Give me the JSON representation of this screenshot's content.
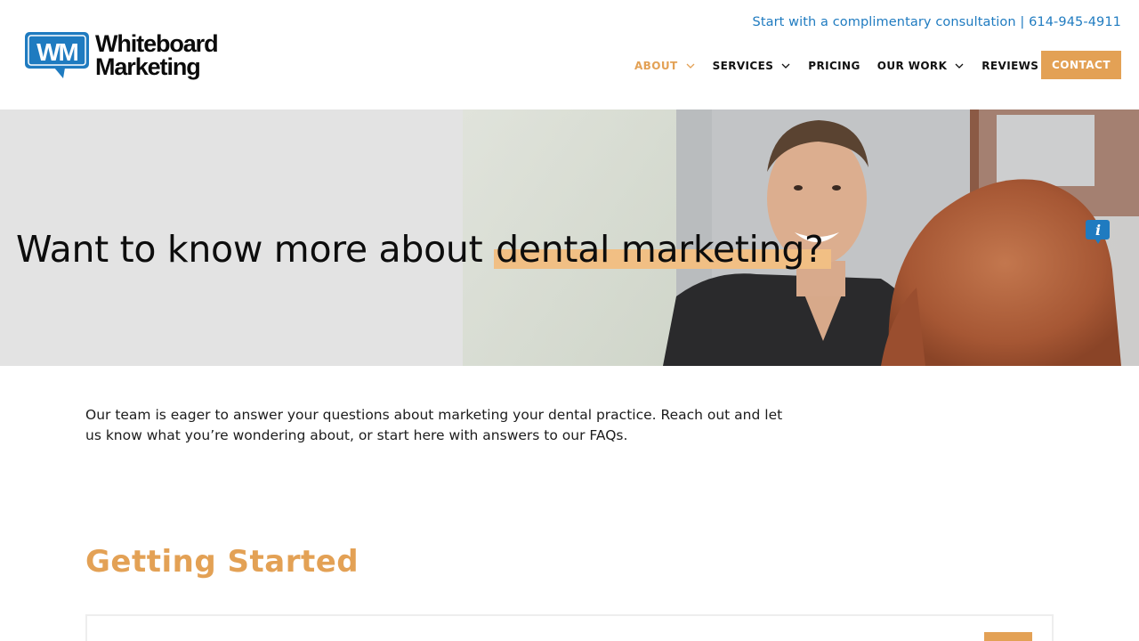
{
  "brand": {
    "logo_initials": "WM",
    "name_line1": "Whiteboard",
    "name_line2": "Marketing",
    "blue": "#1f7bc0",
    "orange": "#e3a155"
  },
  "header": {
    "topbar_text": "Start with a complimentary consultation | 614-945-4911",
    "nav": [
      {
        "label": "ABOUT",
        "has_dropdown": true,
        "active": true
      },
      {
        "label": "SERVICES",
        "has_dropdown": true
      },
      {
        "label": "PRICING",
        "has_dropdown": false
      },
      {
        "label": "OUR WORK",
        "has_dropdown": true
      },
      {
        "label": "REVIEWS",
        "has_dropdown": false
      }
    ],
    "contact_label": "CONTACT",
    "dropdown_icon": "chevron-down-icon"
  },
  "hero": {
    "title_plain": "Want to know more about ",
    "title_highlight": "dental marketing?",
    "badge_icon": "info-icon",
    "badge_glyph": "i"
  },
  "content": {
    "intro": "Our team is eager to answer your questions about marketing your dental practice. Reach out and let us know what you’re wondering about, or start here with answers to our FAQs.",
    "section_title": "Getting Started"
  }
}
